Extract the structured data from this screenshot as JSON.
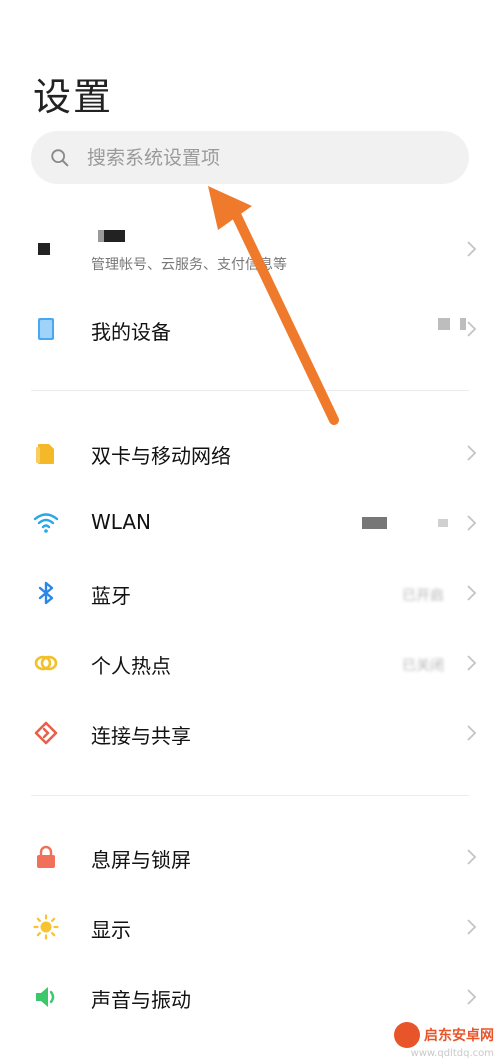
{
  "header": {
    "title": "设置"
  },
  "search": {
    "placeholder": "搜索系统设置项"
  },
  "account": {
    "subtitle": "管理帐号、云服务、支付信息等"
  },
  "sections": [
    [
      {
        "label": "我的设备",
        "icon": "device-icon",
        "value": ""
      }
    ],
    [
      {
        "label": "双卡与移动网络",
        "icon": "sim-card-icon",
        "value": ""
      },
      {
        "label": "WLAN",
        "icon": "wifi-icon",
        "value": ""
      },
      {
        "label": "蓝牙",
        "icon": "bluetooth-icon",
        "value": "已开启"
      },
      {
        "label": "个人热点",
        "icon": "hotspot-icon",
        "value": "已关闭"
      },
      {
        "label": "连接与共享",
        "icon": "connection-share-icon",
        "value": ""
      }
    ],
    [
      {
        "label": "息屏与锁屏",
        "icon": "lock-icon",
        "value": ""
      },
      {
        "label": "显示",
        "icon": "brightness-icon",
        "value": ""
      },
      {
        "label": "声音与振动",
        "icon": "sound-icon",
        "value": ""
      }
    ]
  ],
  "watermark": {
    "brand": "启东安卓网",
    "url": "www.qdltdq.com"
  },
  "colors": {
    "accent_arrow": "#f07a2b",
    "sim": "#f5b829",
    "wifi": "#2aa5e8",
    "bluetooth": "#2a87e8",
    "hotspot": "#f2c12a",
    "share": "#e8604a",
    "lock": "#f0705a",
    "display": "#f7c330",
    "sound": "#3cc86a",
    "device": "#4aa8f0"
  }
}
